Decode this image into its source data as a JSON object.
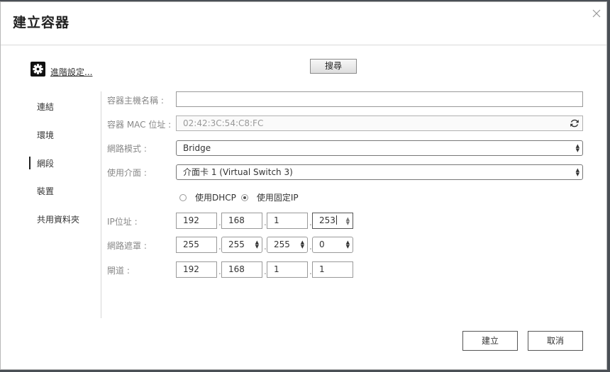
{
  "dialog": {
    "title": "建立容器",
    "advanced_link": "進階設定...",
    "search_button": "搜尋"
  },
  "nav": {
    "items": [
      {
        "label": "連結"
      },
      {
        "label": "環境"
      },
      {
        "label": "網段"
      },
      {
        "label": "裝置"
      },
      {
        "label": "共用資料夾"
      }
    ],
    "active": "網段"
  },
  "form": {
    "hostname": {
      "label": "容器主機名稱 :",
      "value": ""
    },
    "mac": {
      "label": "容器 MAC 位址 :",
      "value": "02:42:3C:54:C8:FC"
    },
    "network_mode": {
      "label": "網路模式 :",
      "value": "Bridge"
    },
    "interface": {
      "label": "使用介面 :",
      "value": "介面卡 1 (Virtual Switch 3)"
    },
    "dhcp_label": "使用DHCP",
    "static_label": "使用固定IP",
    "ip": {
      "label": "IP位址 :",
      "octets": [
        "192",
        "168",
        "1",
        "253"
      ]
    },
    "netmask": {
      "label": "網路遮罩 :",
      "octets": [
        "255",
        "255",
        "255",
        "0"
      ]
    },
    "gateway": {
      "label": "閘道 :",
      "octets": [
        "192",
        "168",
        "1",
        "1"
      ]
    },
    "separator": "."
  },
  "footer": {
    "create_button": "建立",
    "cancel_button": "取消"
  }
}
